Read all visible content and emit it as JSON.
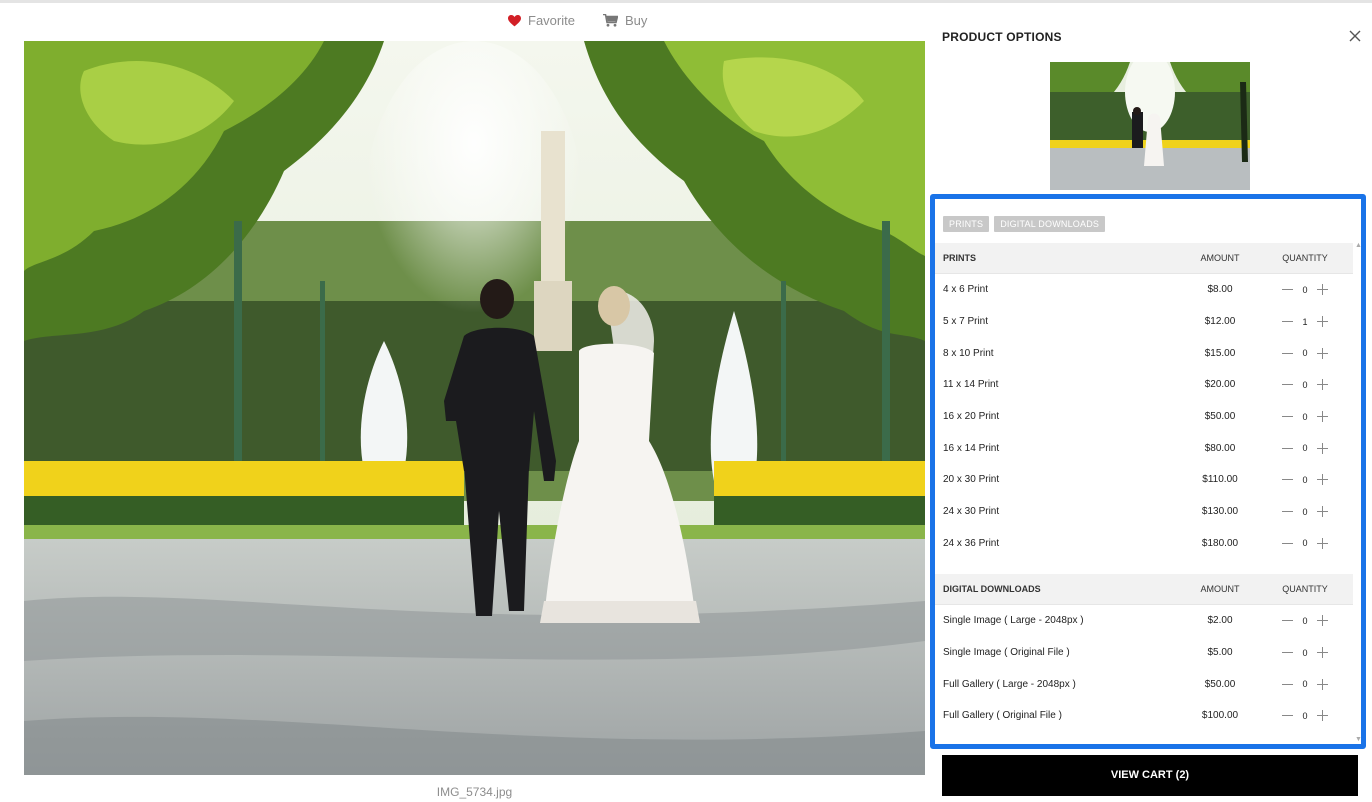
{
  "actions": {
    "favorite_label": "Favorite",
    "buy_label": "Buy",
    "favorite_icon": "heart-icon",
    "buy_icon": "shopping-cart-icon",
    "favorite_color": "#d21f26"
  },
  "photo": {
    "filename": "IMG_5734.jpg"
  },
  "panel": {
    "title": "PRODUCT OPTIONS",
    "close_icon": "close-icon",
    "tabs": [
      "PRINTS",
      "DIGITAL DOWNLOADS"
    ],
    "prints": {
      "heading": "PRINTS",
      "amount_header": "AMOUNT",
      "quantity_header": "QUANTITY",
      "items": [
        {
          "name": "4 x 6 Print",
          "amount": "$8.00",
          "qty": "0"
        },
        {
          "name": "5 x 7 Print",
          "amount": "$12.00",
          "qty": "1"
        },
        {
          "name": "8 x 10 Print",
          "amount": "$15.00",
          "qty": "0"
        },
        {
          "name": "11 x 14 Print",
          "amount": "$20.00",
          "qty": "0"
        },
        {
          "name": "16 x 20 Print",
          "amount": "$50.00",
          "qty": "0"
        },
        {
          "name": "16 x 14 Print",
          "amount": "$80.00",
          "qty": "0"
        },
        {
          "name": "20 x 30 Print",
          "amount": "$110.00",
          "qty": "0"
        },
        {
          "name": "24 x 30 Print",
          "amount": "$130.00",
          "qty": "0"
        },
        {
          "name": "24 x 36 Print",
          "amount": "$180.00",
          "qty": "0"
        }
      ]
    },
    "downloads": {
      "heading": "DIGITAL DOWNLOADS",
      "amount_header": "AMOUNT",
      "quantity_header": "QUANTITY",
      "items": [
        {
          "name": "Single Image ( Large - 2048px )",
          "amount": "$2.00",
          "qty": "0"
        },
        {
          "name": "Single Image ( Original File )",
          "amount": "$5.00",
          "qty": "0"
        },
        {
          "name": "Full Gallery ( Large - 2048px )",
          "amount": "$50.00",
          "qty": "0"
        },
        {
          "name": "Full Gallery ( Original File )",
          "amount": "$100.00",
          "qty": "0"
        }
      ]
    },
    "view_cart_label": "VIEW CART (2)",
    "highlight_color": "#1a73e8"
  }
}
